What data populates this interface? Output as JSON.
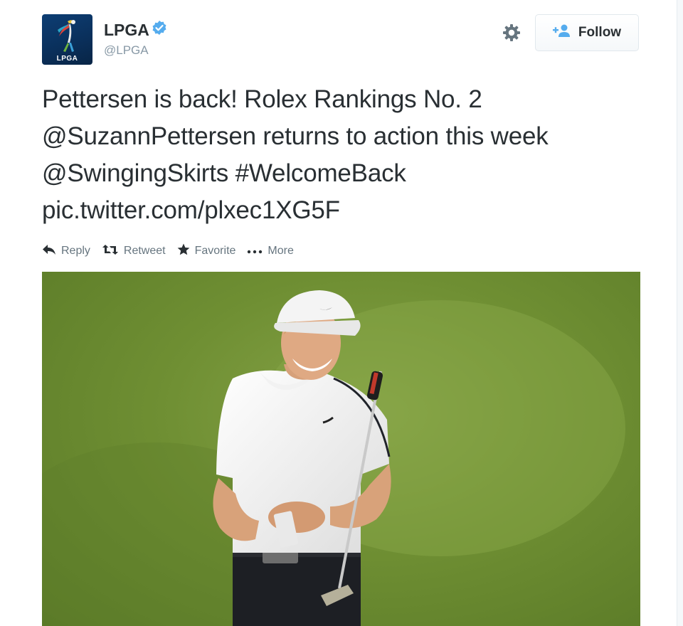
{
  "user": {
    "name": "LPGA",
    "handle": "@LPGA",
    "avatar_text": "LPGA",
    "verified_icon": "verified-badge-icon",
    "verified_color": "#55acee"
  },
  "header": {
    "settings_icon": "gear-icon",
    "follow_label": "Follow",
    "follow_icon": "add-person-icon",
    "accent": "#55acee"
  },
  "tweet": {
    "lines": [
      "Pettersen is back! Rolex Rankings No. 2",
      "@SuzannPettersen returns to action this week",
      "@SwingingSkirts #WelcomeBack",
      "pic.twitter.com/plxec1XG5F"
    ]
  },
  "actions": {
    "reply": "Reply",
    "retweet": "Retweet",
    "favorite": "Favorite",
    "more": "More"
  },
  "photo": {
    "subject": "smiling golfer in white cap and white polo holding a putter on green fairway"
  }
}
